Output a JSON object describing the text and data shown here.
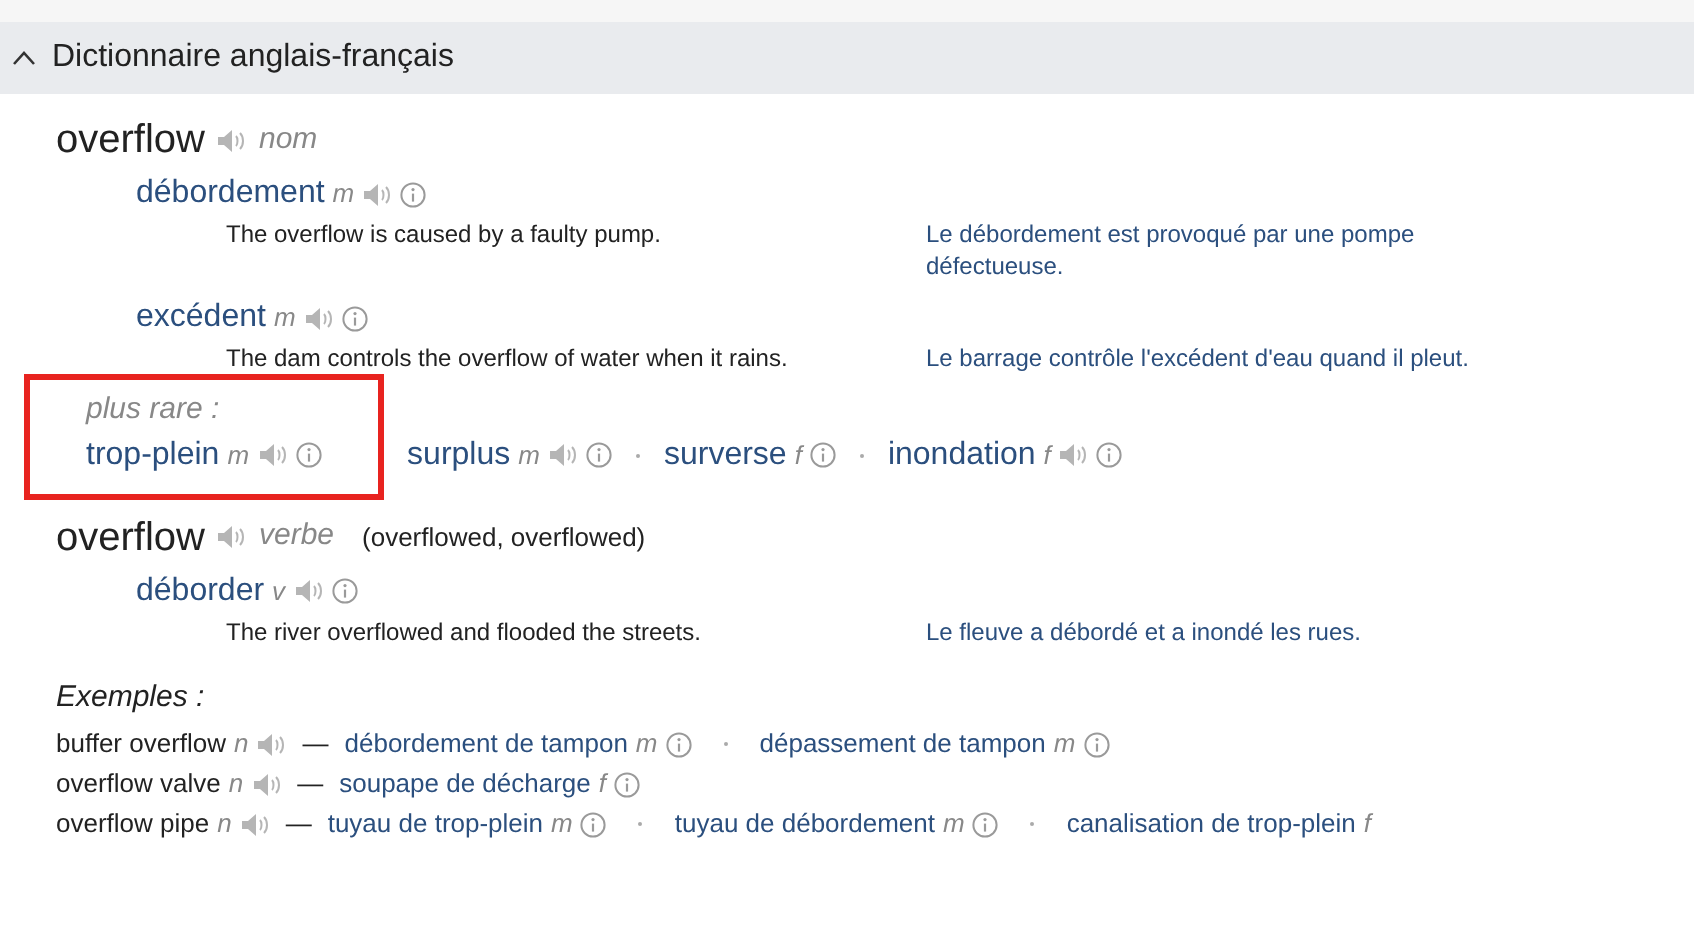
{
  "section": {
    "title": "Dictionnaire anglais-français",
    "expanded": true
  },
  "entries": [
    {
      "headword": "overflow",
      "audio": true,
      "pos": "nom",
      "senses": [
        {
          "word": "débordement",
          "gender": "m",
          "audio": true,
          "info": true,
          "example_en": "The overflow is caused by a faulty pump.",
          "example_fr": "Le débordement est provoqué par une pompe défectueuse."
        },
        {
          "word": "excédent",
          "gender": "m",
          "audio": true,
          "info": true,
          "example_en": "The dam controls the overflow of water when it rains.",
          "example_fr": "Le barrage contrôle l'excédent d'eau quand il pleut."
        }
      ],
      "rare": {
        "label": "plus rare :",
        "highlighted": true,
        "items": [
          {
            "word": "trop-plein",
            "gender": "m",
            "audio": true,
            "info": true
          },
          {
            "word": "surplus",
            "gender": "m",
            "audio": true,
            "info": true
          },
          {
            "word": "surverse",
            "gender": "f",
            "audio": false,
            "info": true
          },
          {
            "word": "inondation",
            "gender": "f",
            "audio": true,
            "info": true
          }
        ]
      }
    },
    {
      "headword": "overflow",
      "audio": true,
      "pos": "verbe",
      "forms": "(overflowed, overflowed)",
      "senses": [
        {
          "word": "déborder",
          "gender": "v",
          "audio": true,
          "info": true,
          "example_en": "The river overflowed and flooded the streets.",
          "example_fr": "Le fleuve a débordé et a inondé les rues."
        }
      ]
    }
  ],
  "examples": {
    "title": "Exemples :",
    "separator": "—",
    "items": [
      {
        "term": "buffer overflow",
        "pos": "n",
        "audio": true,
        "translations": [
          {
            "word": "débordement de tampon",
            "gender": "m",
            "info": true
          },
          {
            "word": "dépassement de tampon",
            "gender": "m",
            "info": true
          }
        ]
      },
      {
        "term": "overflow valve",
        "pos": "n",
        "audio": true,
        "translations": [
          {
            "word": "soupape de décharge",
            "gender": "f",
            "info": true
          }
        ]
      },
      {
        "term": "overflow pipe",
        "pos": "n",
        "audio": true,
        "translations": [
          {
            "word": "tuyau de trop-plein",
            "gender": "m",
            "info": true
          },
          {
            "word": "tuyau de débordement",
            "gender": "m",
            "info": true
          },
          {
            "word": "canalisation de trop-plein",
            "gender": "f",
            "info": false
          }
        ]
      }
    ]
  }
}
